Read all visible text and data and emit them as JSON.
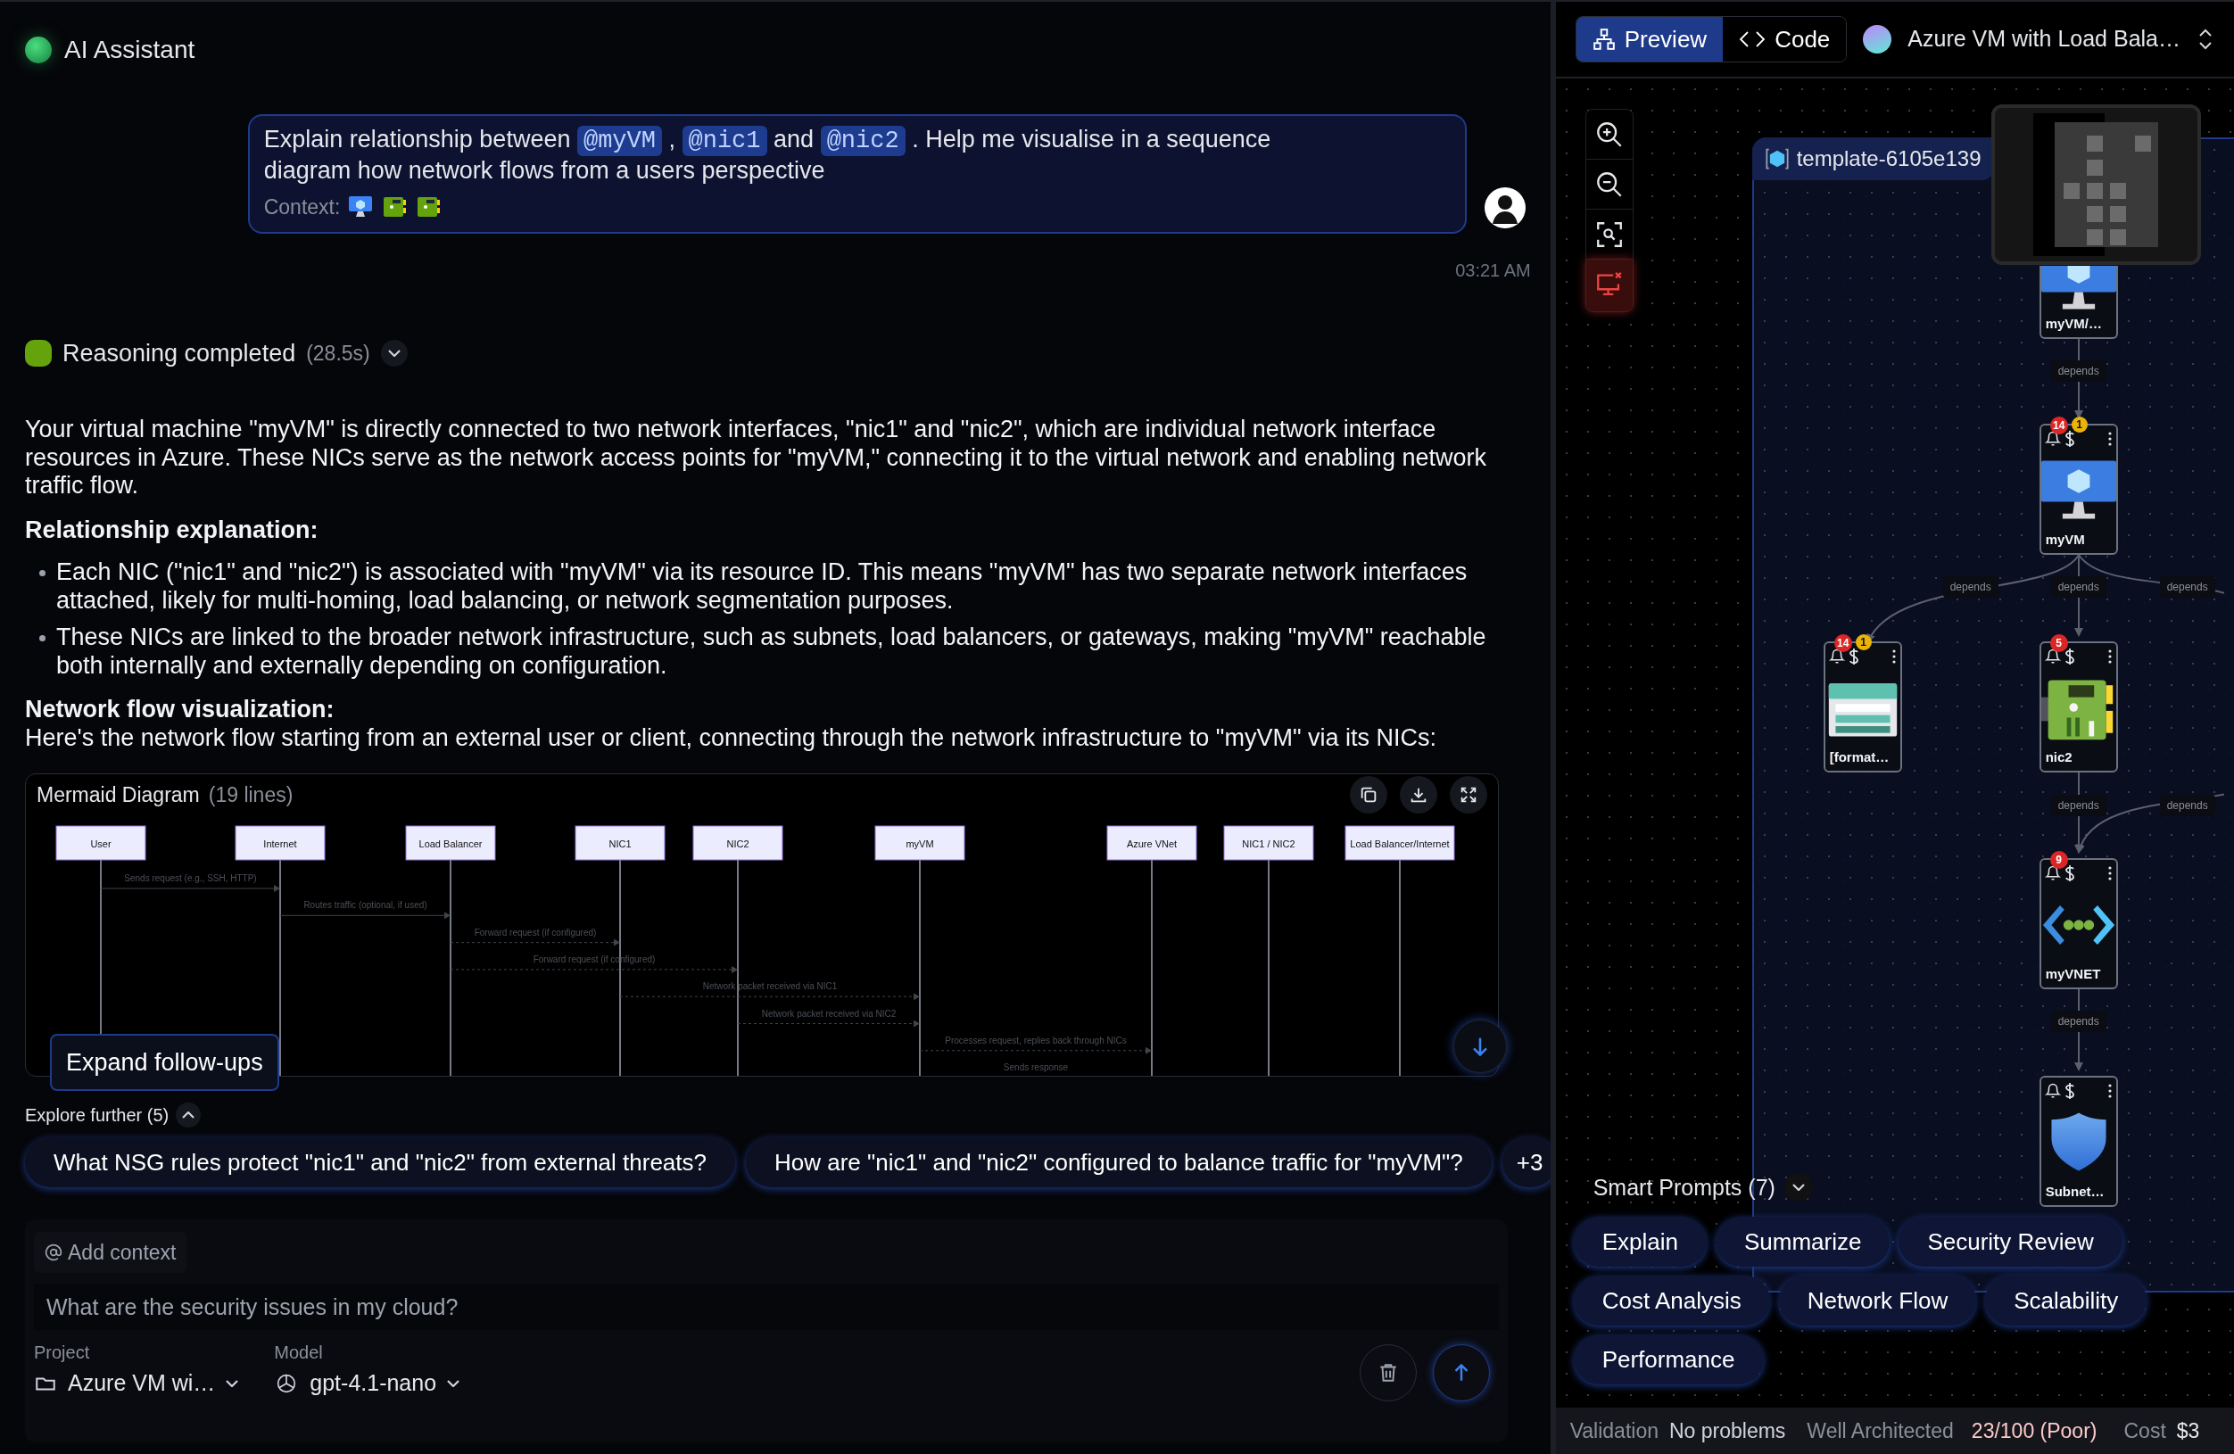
{
  "header": {
    "title": "AI Assistant"
  },
  "user_message": {
    "parts": [
      {
        "kind": "text",
        "text": "Explain relationship between"
      },
      {
        "kind": "mention",
        "text": "@myVM"
      },
      {
        "kind": "text",
        "text": ","
      },
      {
        "kind": "mention",
        "text": "@nic1"
      },
      {
        "kind": "text",
        "text": "and"
      },
      {
        "kind": "mention",
        "text": "@nic2"
      },
      {
        "kind": "text",
        "text": ". Help me visualise in a sequence diagram how network flows from a users perspective"
      }
    ],
    "context_label": "Context:",
    "context_items": [
      {
        "kind": "vm"
      },
      {
        "kind": "nic"
      },
      {
        "kind": "nic"
      }
    ],
    "time": "03:21 AM"
  },
  "reasoning": {
    "label": "Reasoning completed",
    "duration": "(28.5s)",
    "expanded": false
  },
  "answer": {
    "intro": "Your virtual machine \"myVM\" is directly connected to two network interfaces, \"nic1\" and \"nic2\", which are individual network interface resources in Azure. These NICs serve as the network access points for \"myVM,\" connecting it to the virtual network and enabling network traffic flow.",
    "sections": [
      {
        "heading": "Relationship explanation:",
        "bullets": [
          "Each NIC (\"nic1\" and \"nic2\") is associated with \"myVM\" via its resource ID. This means \"myVM\" has two separate network interfaces attached, likely for multi-homing, load balancing, or network segmentation purposes.",
          "These NICs are linked to the broader network infrastructure, such as subnets, load balancers, or gateways, making \"myVM\" reachable both internally and externally depending on configuration."
        ]
      },
      {
        "heading": "Network flow visualization:",
        "text": "Here's the network flow starting from an external user or client, connecting through the network infrastructure to \"myVM\" via its NICs:"
      }
    ]
  },
  "diagram": {
    "title": "Mermaid Diagram",
    "line_count": "(19 lines)",
    "participants": [
      "User",
      "Internet",
      "Load Balancer",
      "NIC1",
      "NIC2",
      "myVM",
      "Azure VNet",
      "NIC1 / NIC2",
      "Load Balancer/Internet"
    ],
    "messages": [
      {
        "label": "Sends request (e.g., SSH, HTTP)",
        "dashed": false
      },
      {
        "label": "Routes traffic (optional, if used)",
        "dashed": false
      },
      {
        "label": "Forward request (if configured)",
        "dashed": true
      },
      {
        "label": "Forward request (if configured)",
        "dashed": true
      },
      {
        "label": "Network packet received via NIC1",
        "dashed": true
      },
      {
        "label": "Network packet received via NIC2",
        "dashed": true
      },
      {
        "label": "Processes request, replies back through NICs",
        "dashed": true
      },
      {
        "label": "Sends response"
      }
    ],
    "expand_button": "Expand follow-ups"
  },
  "follow_ups": {
    "label": "Explore further (5)",
    "expanded": true,
    "items": [
      "What NSG rules protect \"nic1\" and \"nic2\" from external threats?",
      "How are \"nic1\" and \"nic2\" configured to balance traffic for \"myVM\"?"
    ],
    "more": "+3"
  },
  "composer": {
    "add_context": "Add context",
    "placeholder": "What are the security issues in my cloud?",
    "project_label": "Project",
    "project": "Azure VM wi…",
    "model_label": "Model",
    "model": "gpt-4.1-nano"
  },
  "right_panel": {
    "tabs": [
      {
        "label": "Preview",
        "selected": true
      },
      {
        "label": "Code",
        "selected": false
      }
    ],
    "template": "Azure VM with Load Bala…",
    "group_label": "template-6105e139",
    "nodes": [
      {
        "kind": "vm",
        "label": "myVM/…"
      },
      {
        "kind": "vm",
        "label": "myVM",
        "alerts": "14",
        "cost": "1"
      },
      {
        "kind": "storage",
        "label": "[format…",
        "alerts": "14",
        "cost": "1"
      },
      {
        "kind": "nic",
        "label": "nic2",
        "alerts": "5"
      },
      {
        "kind": "vnet",
        "label": "myVNET",
        "alerts": "9"
      },
      {
        "kind": "shield",
        "label": "Subnet…"
      }
    ],
    "edges": [
      {
        "label": "depends"
      },
      {
        "label": "depends"
      },
      {
        "label": "depends"
      },
      {
        "label": "depends"
      },
      {
        "label": "depends"
      },
      {
        "label": "depends"
      },
      {
        "label": "depends"
      }
    ],
    "smart_prompts": {
      "label": "Smart Prompts (7)",
      "expanded": false,
      "items": [
        "Explain",
        "Summarize",
        "Security Review",
        "Cost Analysis",
        "Network Flow",
        "Scalability",
        "Performance"
      ]
    },
    "status_bar": {
      "validation_label": "Validation",
      "validation": "No problems",
      "wa_label": "Well Architected",
      "wa_score": "23/100 (Poor)",
      "cost_label": "Cost",
      "cost": "$3"
    }
  }
}
